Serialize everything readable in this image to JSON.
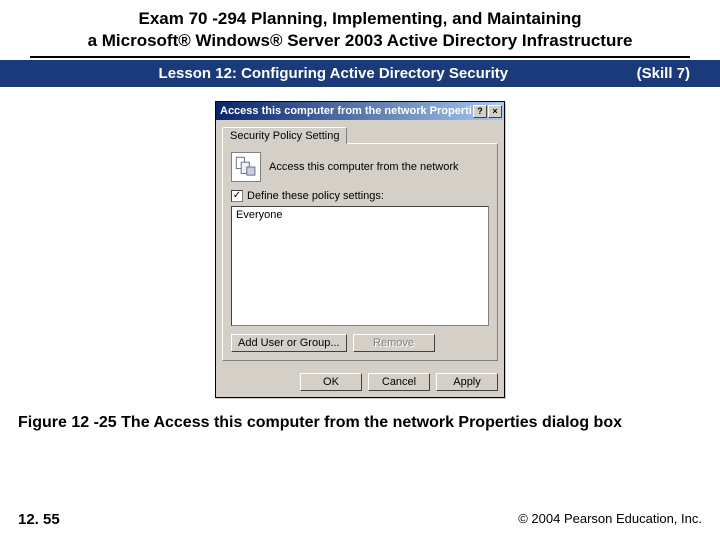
{
  "header": {
    "line1": "Exam 70 -294 Planning, Implementing, and Maintaining",
    "line2": "a Microsoft® Windows® Server 2003 Active Directory Infrastructure"
  },
  "lesson_bar": {
    "lesson": "Lesson 12: Configuring Active Directory Security",
    "skill": "(Skill 7)"
  },
  "dialog": {
    "title": "Access this computer from the network Properties",
    "tab_label": "Security Policy Setting",
    "policy_name": "Access this computer from the network",
    "define_label": "Define these policy settings:",
    "define_checked": "✓",
    "list_item": "Everyone",
    "add_btn": "Add User or Group...",
    "remove_btn": "Remove",
    "ok_btn": "OK",
    "cancel_btn": "Cancel",
    "apply_btn": "Apply",
    "help_btn": "?",
    "close_btn": "×"
  },
  "caption": "Figure 12 -25 The Access this computer from the network Properties dialog box",
  "footer": {
    "page": "12. 55",
    "copyright": "© 2004 Pearson Education, Inc."
  }
}
